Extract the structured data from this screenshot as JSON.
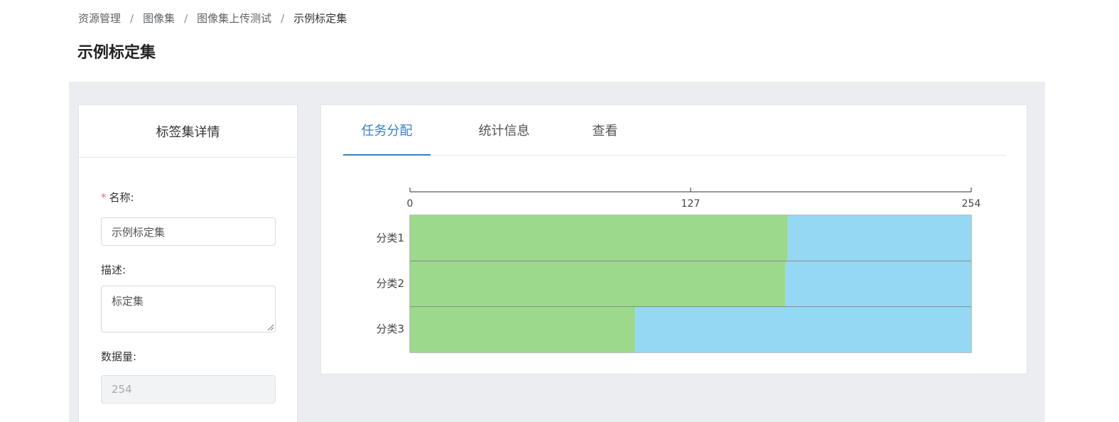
{
  "breadcrumb": {
    "items": [
      "资源管理",
      "图像集",
      "图像集上传测试",
      "示例标定集"
    ],
    "separator": "/"
  },
  "page": {
    "title": "示例标定集"
  },
  "left_panel": {
    "header": "标签集详情",
    "name_required_mark": "*",
    "name_label": "名称:",
    "name_value": "示例标定集",
    "desc_label": "描述:",
    "desc_value": "标定集",
    "count_label": "数据量:",
    "count_value": "254"
  },
  "tabs": [
    {
      "label": "任务分配",
      "active": true
    },
    {
      "label": "统计信息",
      "active": false
    },
    {
      "label": "查看",
      "active": false
    }
  ],
  "colors": {
    "accent": "#3a7ec8",
    "green": "#9cd98d",
    "blue": "#94d8f4"
  },
  "chart_data": {
    "type": "bar",
    "orientation": "horizontal",
    "stacked": true,
    "categories": [
      "分类1",
      "分类2",
      "分类3"
    ],
    "axis_ticks": [
      "0",
      "127",
      "254"
    ],
    "xlim": [
      0,
      254
    ],
    "series": [
      {
        "color": "#9cd98d",
        "values": [
          171,
          170,
          102
        ]
      },
      {
        "color": "#94d8f4",
        "values": [
          83,
          84,
          152
        ]
      }
    ]
  }
}
